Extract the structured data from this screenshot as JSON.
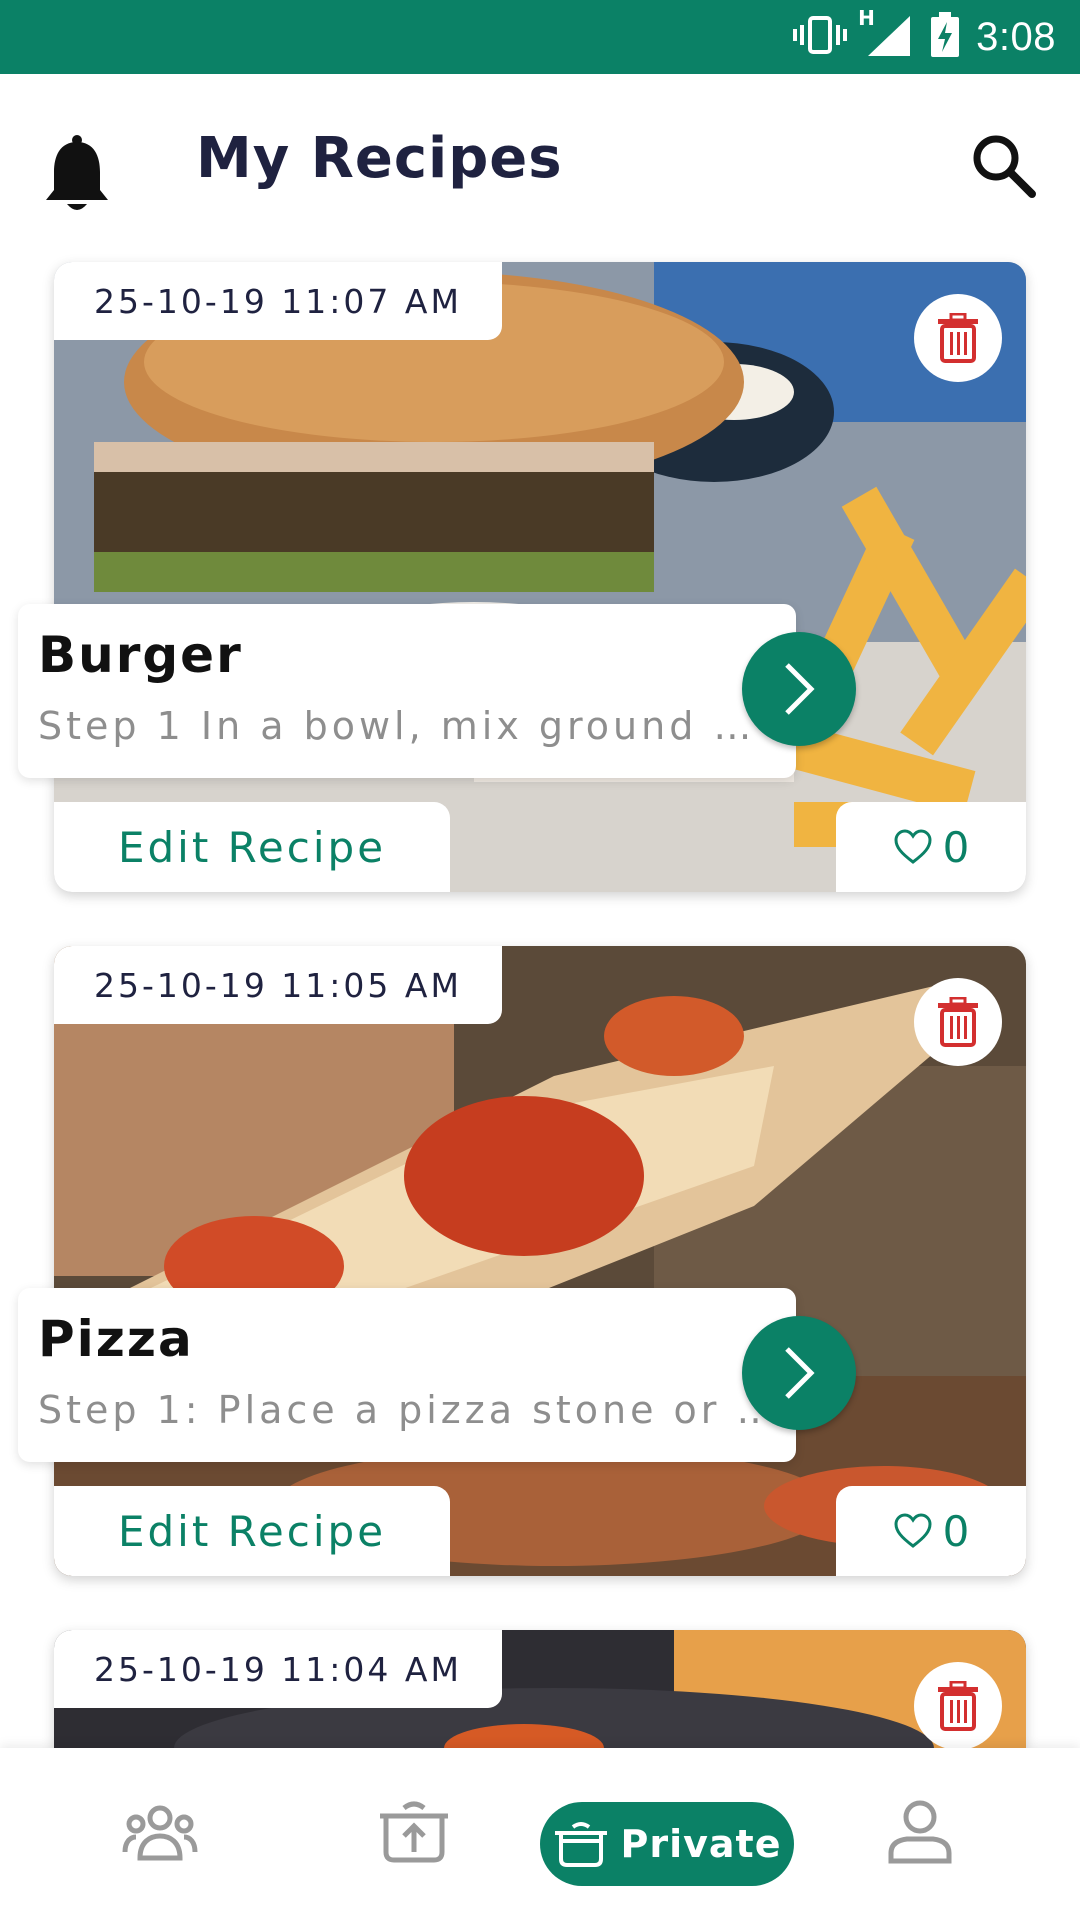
{
  "status_bar": {
    "time": "3:08",
    "network": "H"
  },
  "header": {
    "title": "My Recipes"
  },
  "recipes": [
    {
      "date": "25-10-19 11:07 AM",
      "name": "Burger",
      "description": "Step 1 In a bowl, mix ground …",
      "edit_label": "Edit Recipe",
      "likes": "0"
    },
    {
      "date": "25-10-19 11:05 AM",
      "name": "Pizza",
      "description": "Step 1: Place a pizza stone or …",
      "edit_label": "Edit Recipe",
      "likes": "0"
    },
    {
      "date": "25-10-19 11:04 AM"
    }
  ],
  "bottom_nav": {
    "items": [
      {
        "icon": "community-icon"
      },
      {
        "icon": "upload-pot-icon"
      },
      {
        "icon": "pot-icon",
        "label": "Private",
        "active": true
      },
      {
        "icon": "profile-icon"
      }
    ]
  },
  "colors": {
    "primary": "#0b8166",
    "delete": "#d32f2f",
    "title": "#1f2240"
  }
}
